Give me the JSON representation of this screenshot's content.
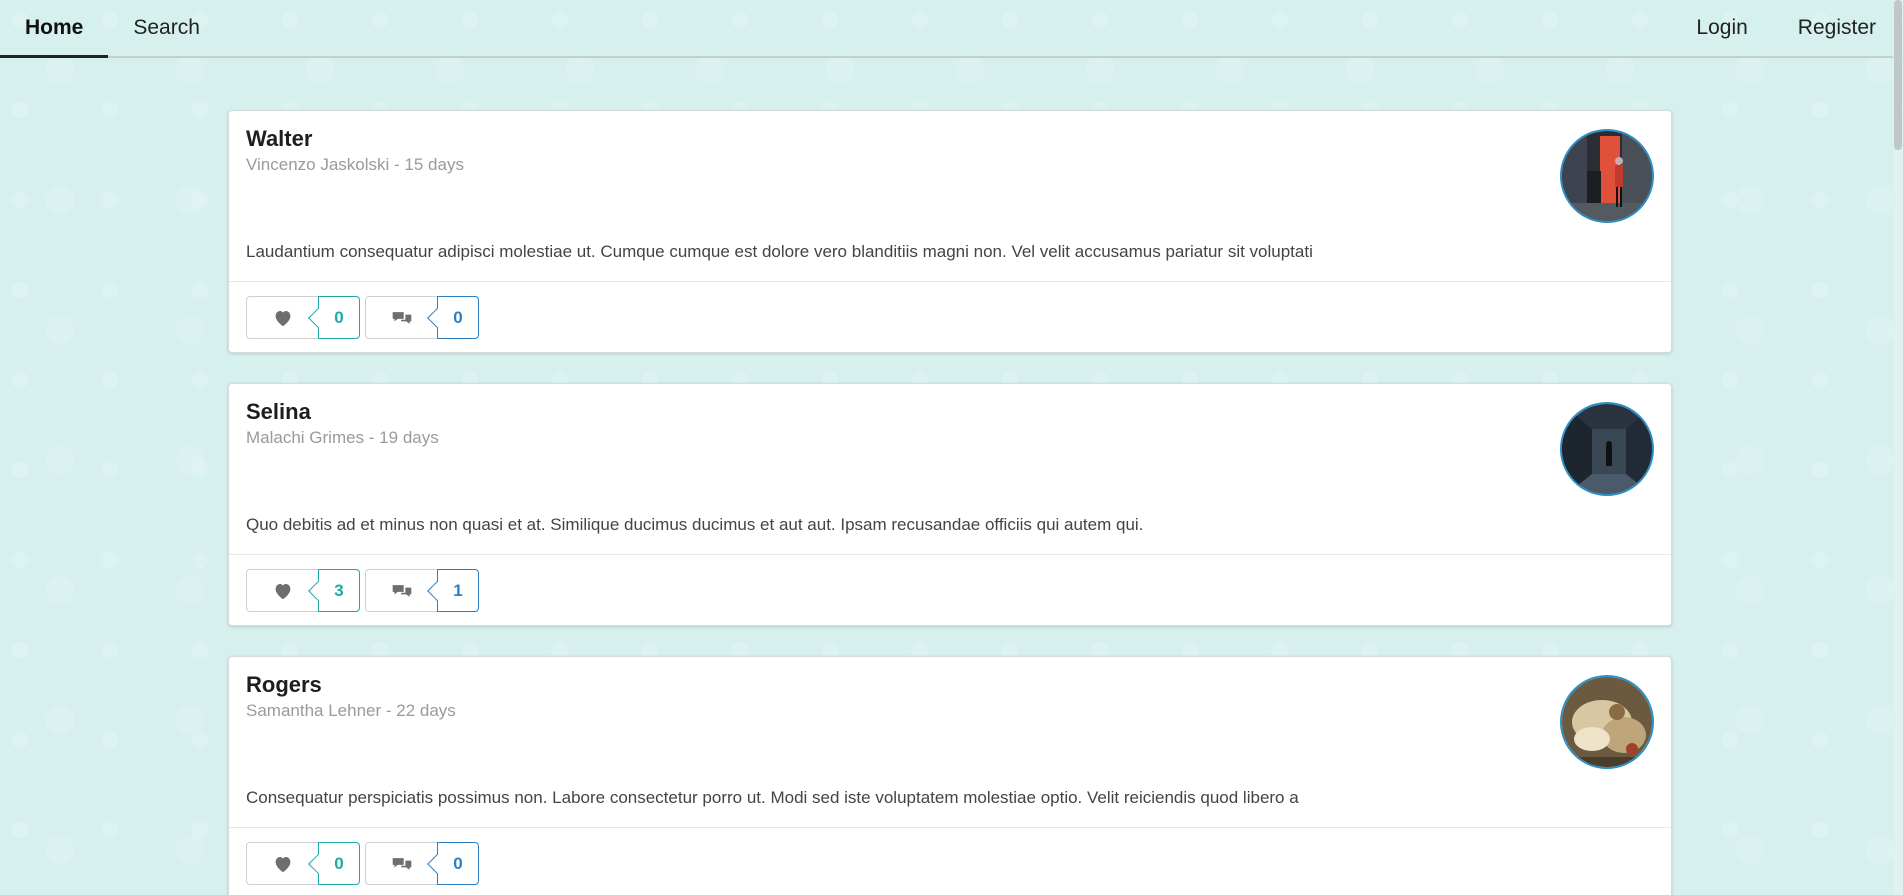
{
  "nav": {
    "home": "Home",
    "search": "Search",
    "login": "Login",
    "register": "Register"
  },
  "colors": {
    "like_accent": "#1fa9a5",
    "comment_accent": "#2b7fc4",
    "avatar_border": "#2b90c8"
  },
  "posts": [
    {
      "title": "Walter",
      "meta": "Vincenzo Jaskolski - 15 days",
      "description": "Laudantium consequatur adipisci molestiae ut. Cumque cumque est dolore vero blanditiis magni non. Vel velit accusamus pariatur sit voluptati",
      "likes": "0",
      "comments": "0",
      "avatar": "photo-person-red-door"
    },
    {
      "title": "Selina",
      "meta": "Malachi Grimes - 19 days",
      "description": "Quo debitis ad et minus non quasi et at. Similique ducimus ducimus et aut aut. Ipsam recusandae officiis qui autem qui.",
      "likes": "3",
      "comments": "1",
      "avatar": "photo-corridor"
    },
    {
      "title": "Rogers",
      "meta": "Samantha Lehner - 22 days",
      "description": "Consequatur perspiciatis possimus non. Labore consectetur porro ut. Modi sed iste voluptatem molestiae optio. Velit reiciendis quod libero a",
      "likes": "0",
      "comments": "0",
      "avatar": "photo-food"
    }
  ],
  "icons": {
    "like": "heart-icon",
    "comment": "comments-icon"
  }
}
